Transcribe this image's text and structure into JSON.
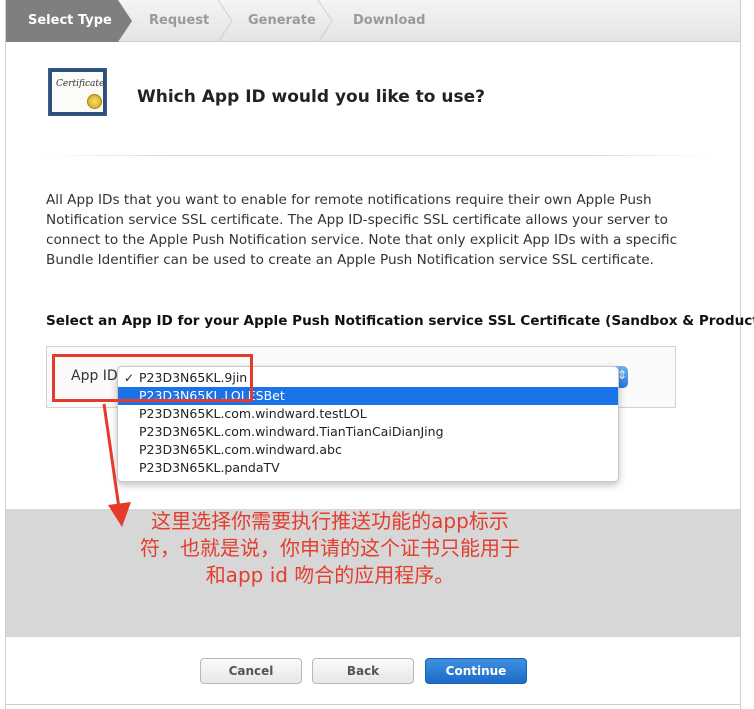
{
  "steps": [
    "Select Type",
    "Request",
    "Generate",
    "Download"
  ],
  "active_step": 0,
  "cert_icon_text": "Certificate",
  "title": "Which App ID would you like to use?",
  "description": "All App IDs that you want to enable for remote notifications require their own Apple Push Notification service SSL certificate. The App ID-specific SSL certificate allows your server to connect to the Apple Push Notification service. Note that only explicit App IDs with a specific Bundle Identifier can be used to create an Apple Push Notification service SSL certificate.",
  "select_heading": "Select an App ID for your Apple Push Notification service SSL Certificate (Sandbox & Production)",
  "app_id_label": "App ID:",
  "dropdown": {
    "checked_item": "P23D3N65KL.9jin",
    "items": [
      "P23D3N65KL.9jin",
      "P23D3N65KL.LOLESBet",
      "P23D3N65KL.com.windward.testLOL",
      "P23D3N65KL.com.windward.TianTianCaiDianJing",
      "P23D3N65KL.com.windward.abc",
      "P23D3N65KL.pandaTV"
    ],
    "highlighted_index": 1
  },
  "annotation": "这里选择你需要执行推送功能的app标示符，也就是说，你申请的这个证书只能用于和app id 吻合的应用程序。",
  "buttons": {
    "cancel": "Cancel",
    "back": "Back",
    "continue": "Continue"
  },
  "colors": {
    "accent": "#1a73e8",
    "annotation": "#e33d2e",
    "active_step": "#7a7a7a"
  }
}
